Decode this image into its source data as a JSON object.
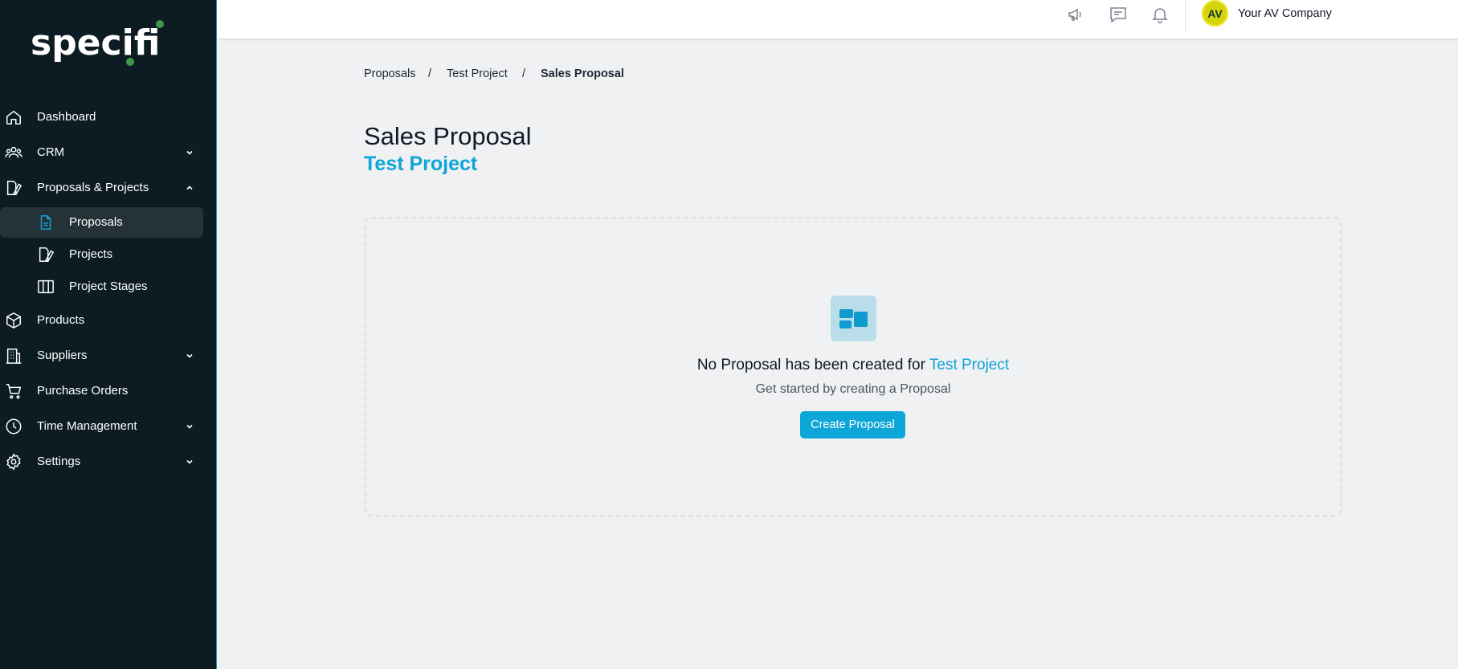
{
  "brand": {
    "logo_text": "specifi",
    "accent": "#0ea5d8",
    "logo_dot": "#3e9a4b"
  },
  "sidebar": {
    "items": [
      {
        "label": "Dashboard",
        "icon": "home-icon"
      },
      {
        "label": "CRM",
        "icon": "users-icon",
        "expandable": true
      },
      {
        "label": "Proposals & Projects",
        "icon": "document-icon",
        "expanded": true,
        "children": [
          {
            "label": "Proposals",
            "icon": "file-text-icon",
            "active": true
          },
          {
            "label": "Projects",
            "icon": "document-icon"
          },
          {
            "label": "Project Stages",
            "icon": "columns-icon"
          }
        ]
      },
      {
        "label": "Products",
        "icon": "box-icon"
      },
      {
        "label": "Suppliers",
        "icon": "building-icon",
        "expandable": true
      },
      {
        "label": "Purchase Orders",
        "icon": "cart-icon"
      },
      {
        "label": "Time Management",
        "icon": "clock-icon",
        "expandable": true
      },
      {
        "label": "Settings",
        "icon": "gear-icon",
        "expandable": true
      }
    ]
  },
  "topbar": {
    "icons": [
      "megaphone-icon",
      "chat-icon",
      "bell-icon"
    ],
    "avatar_initials": "AV",
    "company_name": "Your AV Company"
  },
  "breadcrumb": {
    "items": [
      "Proposals",
      "Test Project",
      "Sales Proposal"
    ],
    "separator": "/"
  },
  "page": {
    "title": "Sales Proposal",
    "subtitle": "Test Project"
  },
  "empty_state": {
    "heading_prefix": "No Proposal has been created for",
    "heading_project": "Test Project",
    "subtext": "Get started by creating a Proposal",
    "button_label": "Create Proposal"
  }
}
